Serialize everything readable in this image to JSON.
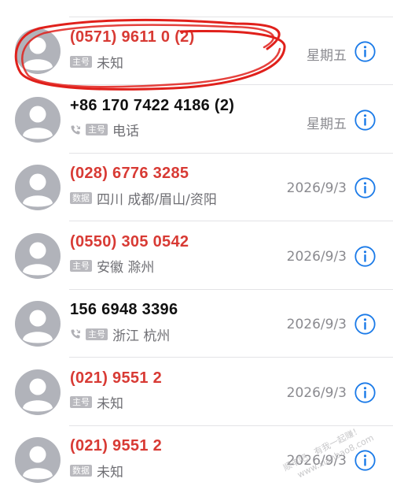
{
  "rows": [
    {
      "name": "(0571) 9611 0 (2)",
      "missed": true,
      "tag": "主号",
      "has_phone_icon": false,
      "location": "未知",
      "date": "星期五"
    },
    {
      "name": "+86 170 7422 4186 (2)",
      "missed": false,
      "tag": "主号",
      "has_phone_icon": true,
      "location": "电话",
      "date": "星期五"
    },
    {
      "name": "(028) 6776 3285",
      "missed": true,
      "tag": "数据",
      "has_phone_icon": false,
      "location": "四川 成都/眉山/资阳",
      "date": "2026/9/3"
    },
    {
      "name": "(0550) 305 0542",
      "missed": true,
      "tag": "主号",
      "has_phone_icon": false,
      "location": "安徽 滁州",
      "date": "2026/9/3"
    },
    {
      "name": "156 6948 3396",
      "missed": false,
      "tag": "主号",
      "has_phone_icon": true,
      "location": "浙江 杭州",
      "date": "2026/9/3"
    },
    {
      "name": "(021) 9551 2",
      "missed": true,
      "tag": "主号",
      "has_phone_icon": false,
      "location": "未知",
      "date": "2026/9/3"
    },
    {
      "name": "(021) 9551 2",
      "missed": true,
      "tag": "数据",
      "has_phone_icon": false,
      "location": "未知",
      "date": "2026/9/3"
    }
  ],
  "icons": {
    "avatar": "avatar-icon",
    "info": "info-icon",
    "phone": "phone-icon"
  },
  "colors": {
    "missed": "#d83a34",
    "normal": "#111111",
    "accent": "#1a7ae8",
    "tag_bg": "#b9b9be",
    "annotation": "#e0201b"
  },
  "watermark": {
    "line1": "顺丰吧，有我一起赚！",
    "line2": "www.xianbao8.com"
  }
}
